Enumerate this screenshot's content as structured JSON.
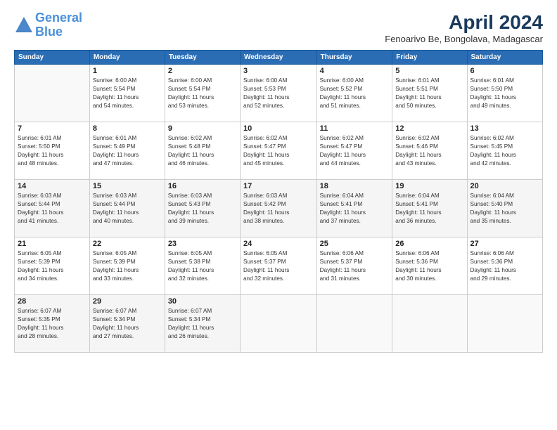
{
  "header": {
    "logo_line1": "General",
    "logo_line2": "Blue",
    "month_title": "April 2024",
    "location": "Fenoarivo Be, Bongolava, Madagascar"
  },
  "weekdays": [
    "Sunday",
    "Monday",
    "Tuesday",
    "Wednesday",
    "Thursday",
    "Friday",
    "Saturday"
  ],
  "weeks": [
    [
      {
        "day": "",
        "info": ""
      },
      {
        "day": "1",
        "info": "Sunrise: 6:00 AM\nSunset: 5:54 PM\nDaylight: 11 hours\nand 54 minutes."
      },
      {
        "day": "2",
        "info": "Sunrise: 6:00 AM\nSunset: 5:54 PM\nDaylight: 11 hours\nand 53 minutes."
      },
      {
        "day": "3",
        "info": "Sunrise: 6:00 AM\nSunset: 5:53 PM\nDaylight: 11 hours\nand 52 minutes."
      },
      {
        "day": "4",
        "info": "Sunrise: 6:00 AM\nSunset: 5:52 PM\nDaylight: 11 hours\nand 51 minutes."
      },
      {
        "day": "5",
        "info": "Sunrise: 6:01 AM\nSunset: 5:51 PM\nDaylight: 11 hours\nand 50 minutes."
      },
      {
        "day": "6",
        "info": "Sunrise: 6:01 AM\nSunset: 5:50 PM\nDaylight: 11 hours\nand 49 minutes."
      }
    ],
    [
      {
        "day": "7",
        "info": "Sunrise: 6:01 AM\nSunset: 5:50 PM\nDaylight: 11 hours\nand 48 minutes."
      },
      {
        "day": "8",
        "info": "Sunrise: 6:01 AM\nSunset: 5:49 PM\nDaylight: 11 hours\nand 47 minutes."
      },
      {
        "day": "9",
        "info": "Sunrise: 6:02 AM\nSunset: 5:48 PM\nDaylight: 11 hours\nand 46 minutes."
      },
      {
        "day": "10",
        "info": "Sunrise: 6:02 AM\nSunset: 5:47 PM\nDaylight: 11 hours\nand 45 minutes."
      },
      {
        "day": "11",
        "info": "Sunrise: 6:02 AM\nSunset: 5:47 PM\nDaylight: 11 hours\nand 44 minutes."
      },
      {
        "day": "12",
        "info": "Sunrise: 6:02 AM\nSunset: 5:46 PM\nDaylight: 11 hours\nand 43 minutes."
      },
      {
        "day": "13",
        "info": "Sunrise: 6:02 AM\nSunset: 5:45 PM\nDaylight: 11 hours\nand 42 minutes."
      }
    ],
    [
      {
        "day": "14",
        "info": "Sunrise: 6:03 AM\nSunset: 5:44 PM\nDaylight: 11 hours\nand 41 minutes."
      },
      {
        "day": "15",
        "info": "Sunrise: 6:03 AM\nSunset: 5:44 PM\nDaylight: 11 hours\nand 40 minutes."
      },
      {
        "day": "16",
        "info": "Sunrise: 6:03 AM\nSunset: 5:43 PM\nDaylight: 11 hours\nand 39 minutes."
      },
      {
        "day": "17",
        "info": "Sunrise: 6:03 AM\nSunset: 5:42 PM\nDaylight: 11 hours\nand 38 minutes."
      },
      {
        "day": "18",
        "info": "Sunrise: 6:04 AM\nSunset: 5:41 PM\nDaylight: 11 hours\nand 37 minutes."
      },
      {
        "day": "19",
        "info": "Sunrise: 6:04 AM\nSunset: 5:41 PM\nDaylight: 11 hours\nand 36 minutes."
      },
      {
        "day": "20",
        "info": "Sunrise: 6:04 AM\nSunset: 5:40 PM\nDaylight: 11 hours\nand 35 minutes."
      }
    ],
    [
      {
        "day": "21",
        "info": "Sunrise: 6:05 AM\nSunset: 5:39 PM\nDaylight: 11 hours\nand 34 minutes."
      },
      {
        "day": "22",
        "info": "Sunrise: 6:05 AM\nSunset: 5:39 PM\nDaylight: 11 hours\nand 33 minutes."
      },
      {
        "day": "23",
        "info": "Sunrise: 6:05 AM\nSunset: 5:38 PM\nDaylight: 11 hours\nand 32 minutes."
      },
      {
        "day": "24",
        "info": "Sunrise: 6:05 AM\nSunset: 5:37 PM\nDaylight: 11 hours\nand 32 minutes."
      },
      {
        "day": "25",
        "info": "Sunrise: 6:06 AM\nSunset: 5:37 PM\nDaylight: 11 hours\nand 31 minutes."
      },
      {
        "day": "26",
        "info": "Sunrise: 6:06 AM\nSunset: 5:36 PM\nDaylight: 11 hours\nand 30 minutes."
      },
      {
        "day": "27",
        "info": "Sunrise: 6:06 AM\nSunset: 5:36 PM\nDaylight: 11 hours\nand 29 minutes."
      }
    ],
    [
      {
        "day": "28",
        "info": "Sunrise: 6:07 AM\nSunset: 5:35 PM\nDaylight: 11 hours\nand 28 minutes."
      },
      {
        "day": "29",
        "info": "Sunrise: 6:07 AM\nSunset: 5:34 PM\nDaylight: 11 hours\nand 27 minutes."
      },
      {
        "day": "30",
        "info": "Sunrise: 6:07 AM\nSunset: 5:34 PM\nDaylight: 11 hours\nand 26 minutes."
      },
      {
        "day": "",
        "info": ""
      },
      {
        "day": "",
        "info": ""
      },
      {
        "day": "",
        "info": ""
      },
      {
        "day": "",
        "info": ""
      }
    ]
  ]
}
